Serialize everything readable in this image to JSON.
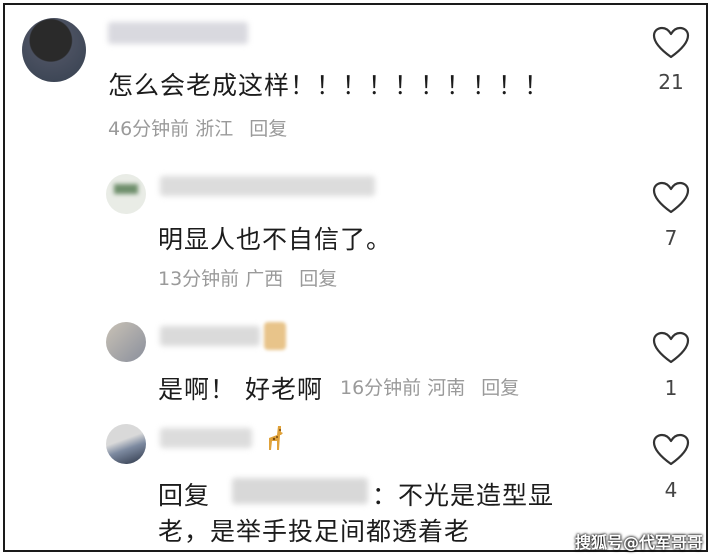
{
  "comments": [
    {
      "text": "怎么会老成这样！！！！！！！！！！",
      "time": "46分钟前",
      "location": "浙江",
      "reply_label": "回复",
      "likes": "21"
    },
    {
      "text": "明显人也不自信了。",
      "time": "13分钟前",
      "location": "广西",
      "reply_label": "回复",
      "likes": "7"
    },
    {
      "text": "是啊！ 好老啊",
      "time": "16分钟前",
      "location": "河南",
      "reply_label": "回复",
      "likes": "1"
    },
    {
      "reply_prefix": "回复",
      "reply_suffix": "：不光是造型显",
      "text_line2": "老，是举手投足间都透着老",
      "likes": "4"
    }
  ],
  "icons": {
    "heart": "heart-outline-icon",
    "giraffe": "giraffe-emoji"
  },
  "watermark": "搜狐号@代军哥哥"
}
